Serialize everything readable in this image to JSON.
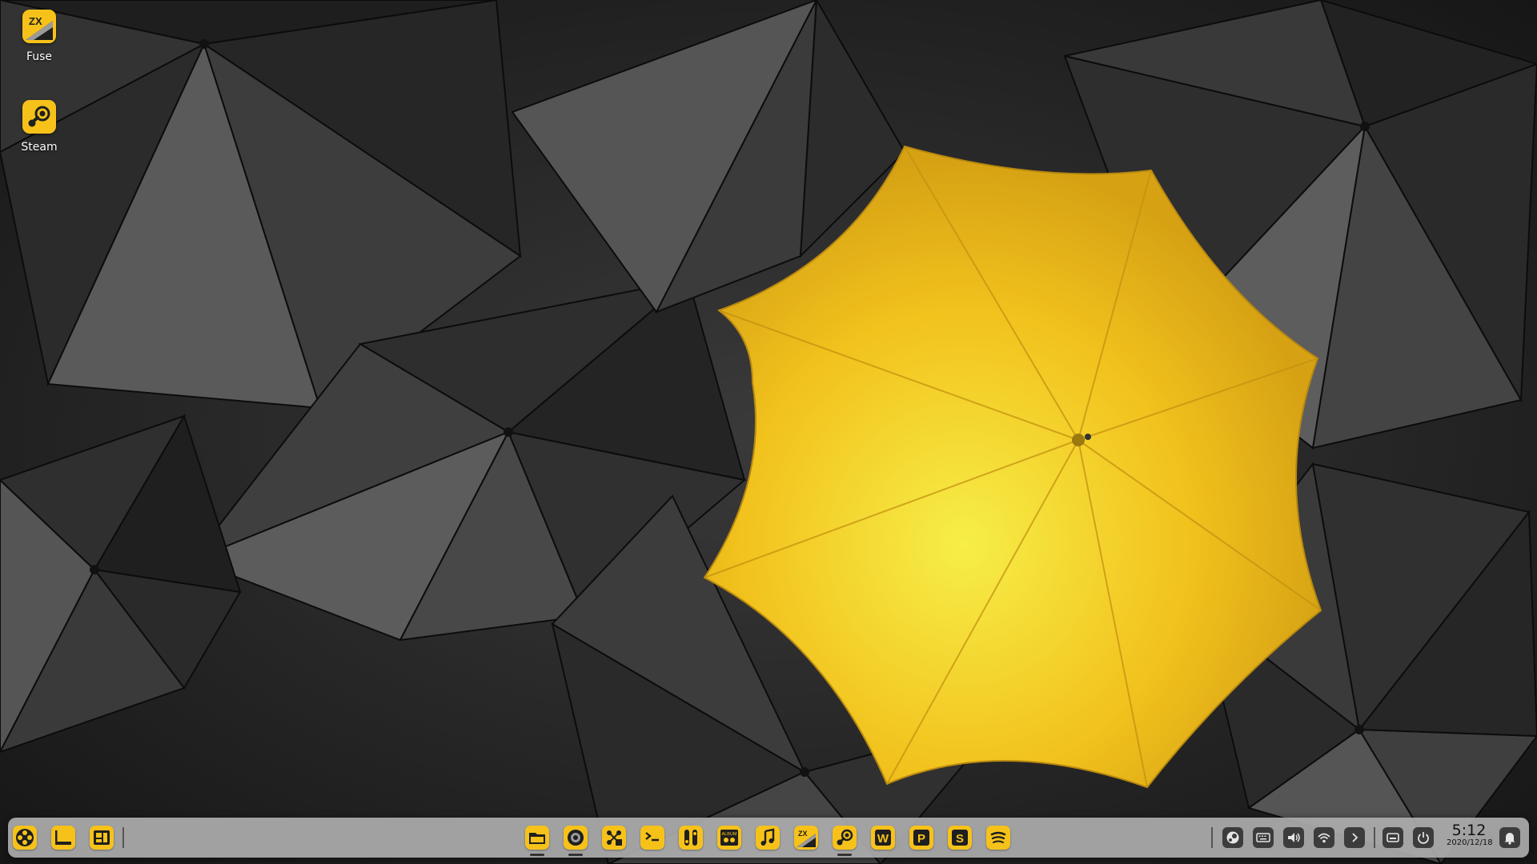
{
  "desktop_icons": [
    {
      "label": "Fuse",
      "icon": "fuse-zx-icon"
    },
    {
      "label": "Steam",
      "icon": "steam-icon"
    }
  ],
  "taskbar": {
    "left": [
      {
        "icon": "launcher-icon"
      },
      {
        "icon": "show-desktop-icon"
      },
      {
        "icon": "multitask-view-icon"
      }
    ],
    "apps": [
      {
        "icon": "file-manager-icon",
        "running": true
      },
      {
        "icon": "browser-icon",
        "running": true
      },
      {
        "icon": "system-monitor-icon",
        "running": false
      },
      {
        "icon": "terminal-icon",
        "running": false
      },
      {
        "icon": "control-center-icon",
        "running": false
      },
      {
        "icon": "album-icon",
        "icon_text": "ALBUM",
        "running": false
      },
      {
        "icon": "music-icon",
        "running": false
      },
      {
        "icon": "fuse-zx-icon",
        "icon_text": "ZX",
        "running": false
      },
      {
        "icon": "steam-icon",
        "running": true
      },
      {
        "icon": "wps-writer-icon",
        "icon_text": "W",
        "running": false
      },
      {
        "icon": "wps-presentation-icon",
        "icon_text": "P",
        "running": false
      },
      {
        "icon": "wps-spreadsheet-icon",
        "icon_text": "S",
        "running": false
      },
      {
        "icon": "spotify-icon",
        "running": false
      }
    ],
    "tray": [
      {
        "icon": "steam-tray-icon"
      },
      {
        "icon": "keyboard-icon"
      },
      {
        "icon": "volume-icon"
      },
      {
        "icon": "wifi-icon"
      },
      {
        "icon": "expand-arrow-icon"
      },
      {
        "icon": "onscreen-keyboard-icon"
      },
      {
        "icon": "power-icon"
      }
    ],
    "clock": {
      "time": "5:12",
      "date": "2020/12/18"
    },
    "notification_icon": "bell-icon"
  },
  "colors": {
    "accent": "#f6c21a",
    "dock_background": "#acacac",
    "tray_button": "#3c3c3c"
  }
}
